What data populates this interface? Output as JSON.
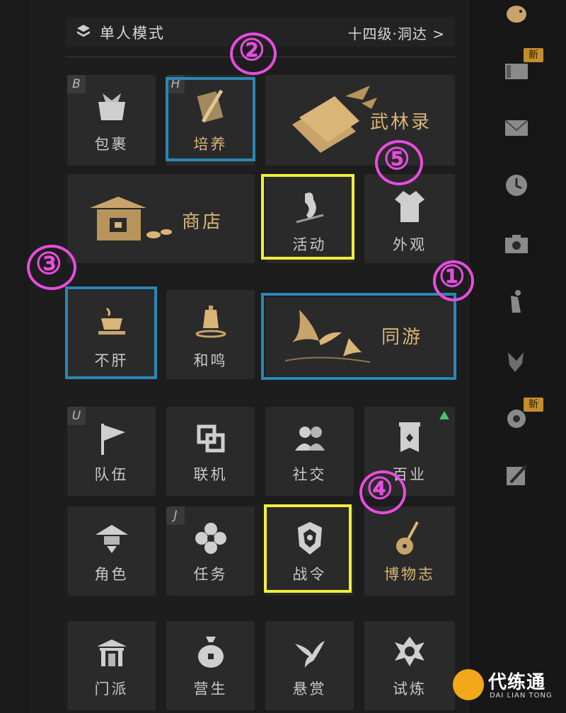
{
  "header": {
    "mode_label": "单人模式",
    "level_label": "十四级·洞达 >"
  },
  "tiles": {
    "bag": {
      "label": "包裹",
      "hotkey": "B"
    },
    "cultivate": {
      "label": "培养",
      "hotkey": "H"
    },
    "wulin": {
      "label": "武林录"
    },
    "shop": {
      "label": "商店"
    },
    "activity": {
      "label": "活动"
    },
    "appearance": {
      "label": "外观"
    },
    "buggan": {
      "label": "不肝"
    },
    "heming": {
      "label": "和鸣"
    },
    "tongyou": {
      "label": "同游"
    },
    "team": {
      "label": "队伍",
      "hotkey": "U"
    },
    "online": {
      "label": "联机"
    },
    "social": {
      "label": "社交"
    },
    "baiye": {
      "label": "百业"
    },
    "role": {
      "label": "角色"
    },
    "task": {
      "label": "任务",
      "hotkey": "J"
    },
    "zhanling": {
      "label": "战令"
    },
    "museum": {
      "label": "博物志"
    },
    "sect": {
      "label": "门派"
    },
    "livelihood": {
      "label": "营生"
    },
    "bounty": {
      "label": "悬赏"
    },
    "trial": {
      "label": "试炼"
    }
  },
  "annotations": [
    "①",
    "②",
    "③",
    "④",
    "⑤"
  ],
  "sidebar": {
    "new_badge_1": "新",
    "new_badge_2": "新",
    "icons": [
      "bird-avatar-icon",
      "card-icon",
      "mail-icon",
      "clock-icon",
      "camera-icon",
      "pose-icon",
      "hand-icon",
      "gear-icon",
      "edit-icon"
    ]
  },
  "brand": {
    "name": "代练通",
    "sub": "DAI LIAN TONG"
  },
  "colors": {
    "gold": "#d9b577",
    "blue_box": "#2a87b5",
    "yellow_box": "#f1ee3b",
    "annotation": "#e84ce0",
    "badge": "#c48d2a"
  }
}
